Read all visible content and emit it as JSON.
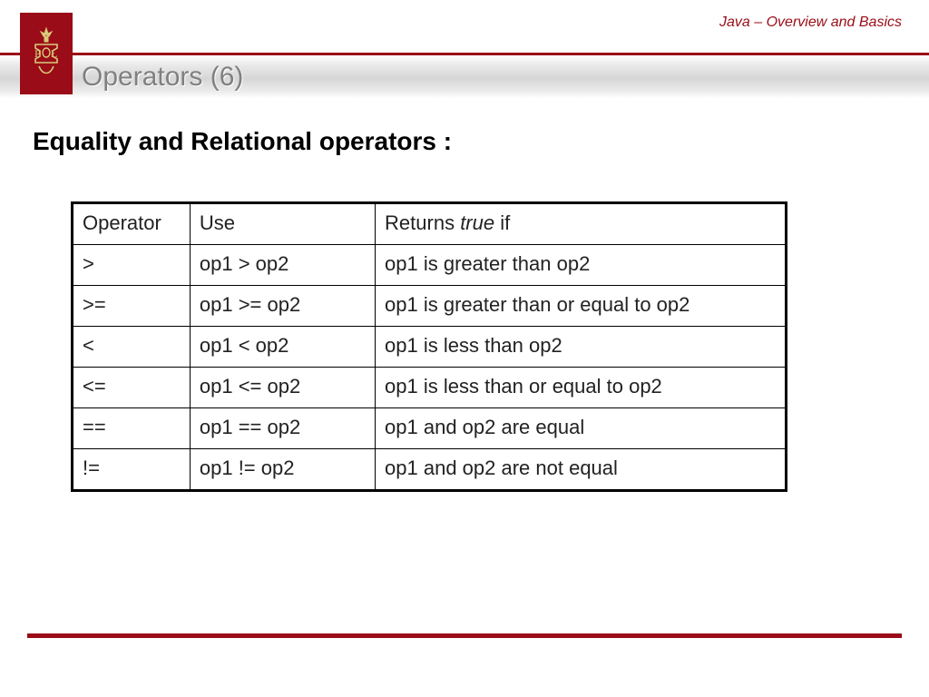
{
  "breadcrumb": "Java – Overview and Basics",
  "slide_title": "Operators (6)",
  "section_heading": "Equality and Relational operators :",
  "table": {
    "headers": {
      "op": "Operator",
      "use": "Use",
      "ret_prefix": "Returns ",
      "ret_italic": "true",
      "ret_suffix": " if"
    },
    "rows": [
      {
        "op": ">",
        "use": " op1 > op2",
        "ret": "op1 is greater than op2"
      },
      {
        "op": ">=",
        "use": "op1 >= op2",
        "ret": "op1 is greater than or equal to op2"
      },
      {
        "op": "<",
        "use": "op1 < op2",
        "ret": "op1 is less than op2"
      },
      {
        "op": "<=",
        "use": "op1 <= op2",
        "ret": "op1 is less than or equal to op2"
      },
      {
        "op": "==",
        "use": "op1 == op2",
        "ret": "op1 and op2 are equal"
      },
      {
        "op": "!=",
        "use": "op1 != op2",
        "ret": "op1 and op2 are not equal"
      }
    ]
  },
  "chart_data": {
    "type": "table",
    "title": "Equality and Relational operators",
    "columns": [
      "Operator",
      "Use",
      "Returns true if"
    ],
    "rows": [
      [
        ">",
        "op1 > op2",
        "op1 is greater than op2"
      ],
      [
        ">=",
        "op1 >= op2",
        "op1 is greater than or equal to op2"
      ],
      [
        "<",
        "op1 < op2",
        "op1 is less than op2"
      ],
      [
        "<=",
        "op1 <= op2",
        "op1 is less than or equal to op2"
      ],
      [
        "==",
        "op1 == op2",
        "op1 and op2 are equal"
      ],
      [
        "!=",
        "op1 != op2",
        "op1 and op2 are not equal"
      ]
    ]
  }
}
